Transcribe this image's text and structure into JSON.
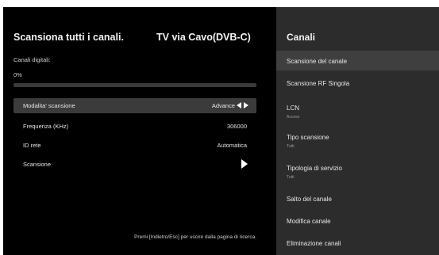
{
  "scan": {
    "title": "Scansiona tutti i canali.",
    "source": "TV via Cavo(DVB-C)",
    "digital_label": "Canali digitali:",
    "percent_text": "0%",
    "progress": 0,
    "rows": [
      {
        "label": "Modalita' scansione",
        "value": "Advance"
      },
      {
        "label": "Frequenza (KHz)",
        "value": "306000"
      },
      {
        "label": "ID rete",
        "value": "Automatica"
      },
      {
        "label": "Scansione",
        "value": ""
      }
    ],
    "hint": "Premi [Indietro/Esc] per uscire dalla pagina di ricerca."
  },
  "panel": {
    "title": "Canali",
    "items": [
      {
        "label": "Scansione del canale",
        "sub": ""
      },
      {
        "label": "Scansione RF Singola",
        "sub": ""
      },
      {
        "label": "LCN",
        "sub": "Acceso"
      },
      {
        "label": "Tipo scansione",
        "sub": "Tutti"
      },
      {
        "label": "Tipologia di servizio",
        "sub": "Tutti"
      },
      {
        "label": "Salto del canale",
        "sub": ""
      },
      {
        "label": "Modifica canale",
        "sub": ""
      },
      {
        "label": "Eliminazione canali",
        "sub": ""
      }
    ]
  },
  "colors": {
    "background": "#000000",
    "panel_background": "#2c2c2c",
    "selected_row": "#3b3b3b",
    "text": "#ffffff"
  }
}
